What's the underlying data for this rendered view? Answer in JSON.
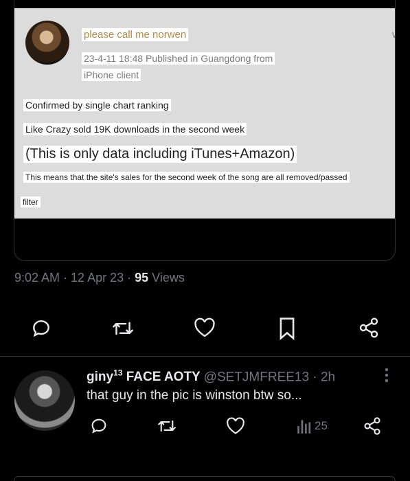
{
  "embedded": {
    "username": "please call me norwen",
    "meta_line1": "23-4-11 18:48 Published in Guangdong from",
    "meta_line2": "iPhone client",
    "line1": "Confirmed by single chart ranking",
    "line2": "Like Crazy sold 19K downloads in the second week",
    "line3": "(This is only data including iTunes+Amazon)",
    "line4": "This means that the site's sales for the second week of the song are all removed/passed",
    "line5": "filter"
  },
  "tweet": {
    "time": "9:02 AM",
    "sep1": " · ",
    "date": "12 Apr 23",
    "sep2": " · ",
    "views_count": "95",
    "views_label": " Views"
  },
  "actions": {
    "icons": [
      "reply-icon",
      "retweet-icon",
      "like-icon",
      "bookmark-icon",
      "share-icon"
    ]
  },
  "reply": {
    "name": "giny",
    "name_sup": "13",
    "name_rest": " FACE AOTY",
    "handle": "@SETJMFREE13",
    "dot": " · ",
    "time": "2h",
    "text": "that guy in the pic is winston btw so...",
    "views": "25"
  },
  "colors": {
    "background": "#000000",
    "text": "#e7e9ea",
    "muted": "#71767b",
    "border": "#2f3336",
    "username_gold": "#b38a45"
  }
}
